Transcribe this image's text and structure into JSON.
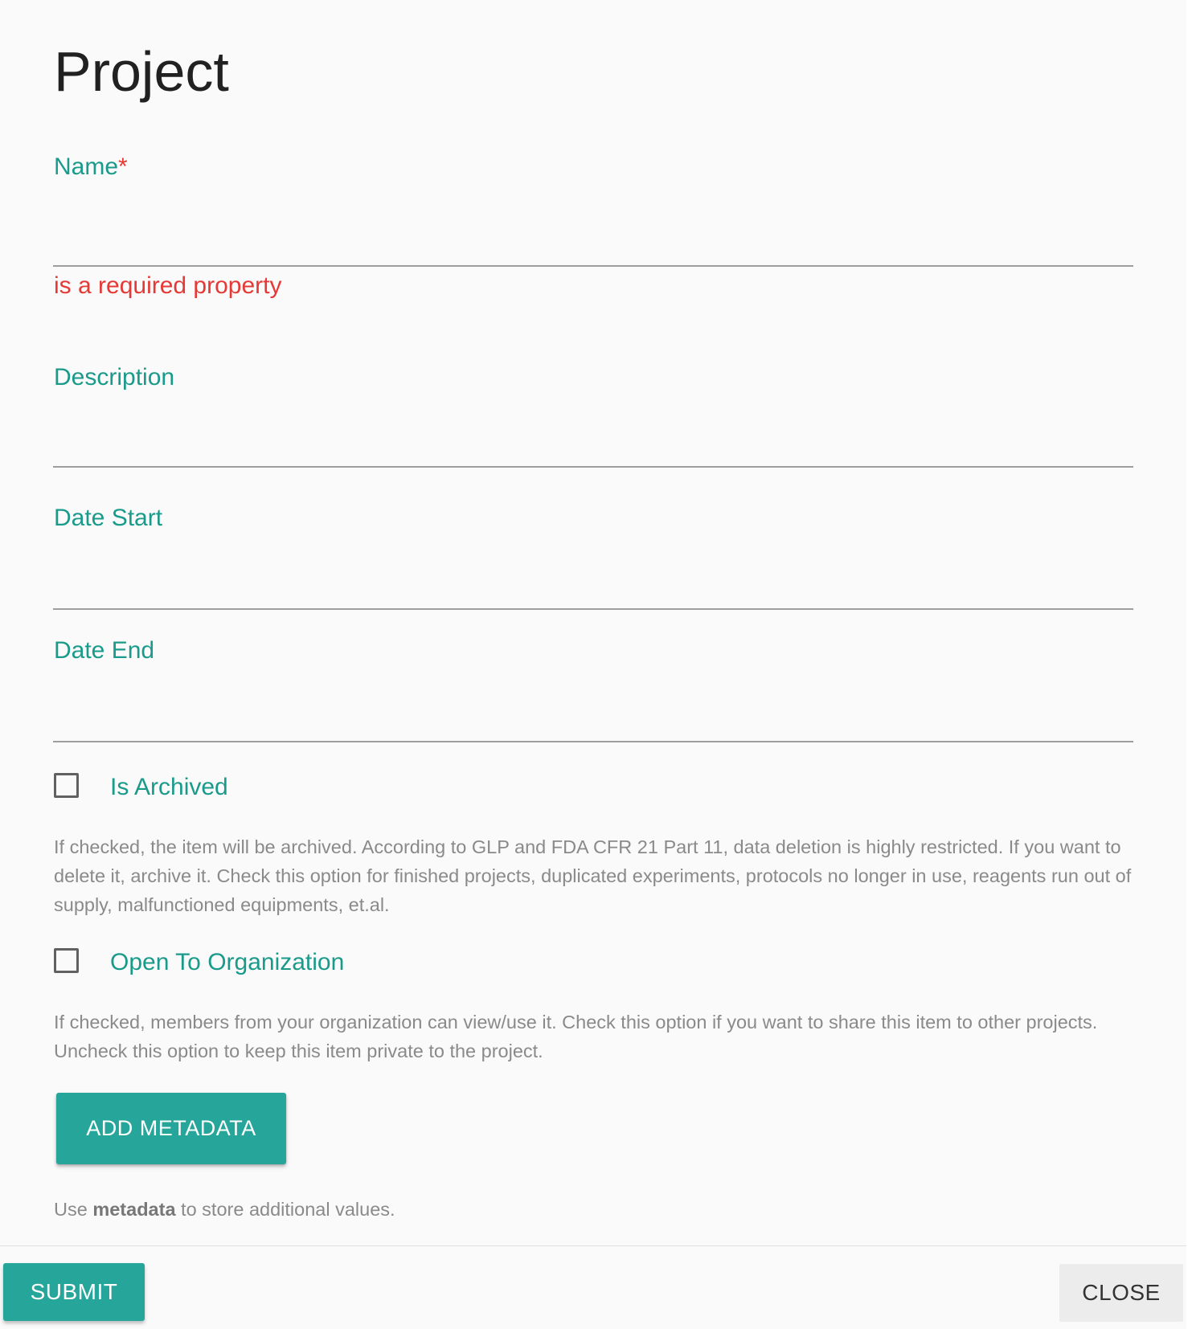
{
  "dialog": {
    "title": "Project"
  },
  "fields": {
    "name": {
      "label": "Name",
      "required_mark": "*",
      "value": "",
      "error": "is a required property"
    },
    "description": {
      "label": "Description",
      "value": ""
    },
    "date_start": {
      "label": "Date Start",
      "value": ""
    },
    "date_end": {
      "label": "Date End",
      "value": ""
    }
  },
  "checkboxes": {
    "is_archived": {
      "label": "Is Archived",
      "checked": false,
      "help": "If checked, the item will be archived. According to GLP and FDA CFR 21 Part 11, data deletion is highly restricted. If you want to delete it, archive it. Check this option for finished projects, duplicated experiments, protocols no longer in use, reagents run out of supply, malfunctioned equipments, et.al."
    },
    "open_to_org": {
      "label": "Open To Organization",
      "checked": false,
      "help": "If checked, members from your organization can view/use it. Check this option if you want to share this item to other projects. Uncheck this option to keep this item private to the project."
    }
  },
  "metadata": {
    "button_label": "ADD METADATA",
    "help_prefix": "Use ",
    "help_bold": "metadata",
    "help_suffix": " to store additional values."
  },
  "footer": {
    "submit_label": "SUBMIT",
    "close_label": "CLOSE"
  },
  "colors": {
    "accent": "#26a69a",
    "label": "#1a9a8a",
    "error": "#e53935",
    "help_text": "#8a8a8a"
  }
}
